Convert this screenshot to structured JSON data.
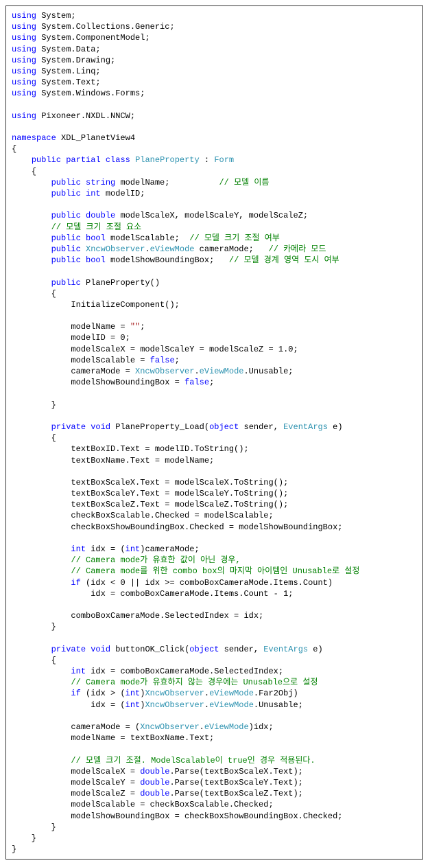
{
  "code": {
    "tokens": [
      {
        "t": "kw",
        "v": "using"
      },
      {
        "v": " System;\n"
      },
      {
        "t": "kw",
        "v": "using"
      },
      {
        "v": " System.Collections.Generic;\n"
      },
      {
        "t": "kw",
        "v": "using"
      },
      {
        "v": " System.ComponentModel;\n"
      },
      {
        "t": "kw",
        "v": "using"
      },
      {
        "v": " System.Data;\n"
      },
      {
        "t": "kw",
        "v": "using"
      },
      {
        "v": " System.Drawing;\n"
      },
      {
        "t": "kw",
        "v": "using"
      },
      {
        "v": " System.Linq;\n"
      },
      {
        "t": "kw",
        "v": "using"
      },
      {
        "v": " System.Text;\n"
      },
      {
        "t": "kw",
        "v": "using"
      },
      {
        "v": " System.Windows.Forms;\n"
      },
      {
        "v": "\n"
      },
      {
        "t": "kw",
        "v": "using"
      },
      {
        "v": " Pixoneer.NXDL.NNCW;\n"
      },
      {
        "v": "\n"
      },
      {
        "t": "kw",
        "v": "namespace"
      },
      {
        "v": " XDL_PlanetView4\n"
      },
      {
        "v": "{\n"
      },
      {
        "v": "    "
      },
      {
        "t": "kw",
        "v": "public"
      },
      {
        "v": " "
      },
      {
        "t": "kw",
        "v": "partial"
      },
      {
        "v": " "
      },
      {
        "t": "kw",
        "v": "class"
      },
      {
        "v": " "
      },
      {
        "t": "type",
        "v": "PlaneProperty"
      },
      {
        "v": " : "
      },
      {
        "t": "type",
        "v": "Form"
      },
      {
        "v": "\n"
      },
      {
        "v": "    {\n"
      },
      {
        "v": "        "
      },
      {
        "t": "kw",
        "v": "public"
      },
      {
        "v": " "
      },
      {
        "t": "kw",
        "v": "string"
      },
      {
        "v": " modelName;          "
      },
      {
        "t": "cm",
        "v": "// 모델 이름"
      },
      {
        "v": "\n"
      },
      {
        "v": "        "
      },
      {
        "t": "kw",
        "v": "public"
      },
      {
        "v": " "
      },
      {
        "t": "kw",
        "v": "int"
      },
      {
        "v": " modelID;\n"
      },
      {
        "v": "\n"
      },
      {
        "v": "        "
      },
      {
        "t": "kw",
        "v": "public"
      },
      {
        "v": " "
      },
      {
        "t": "kw",
        "v": "double"
      },
      {
        "v": " modelScaleX, modelScaleY, modelScaleZ;\n"
      },
      {
        "v": "        "
      },
      {
        "t": "cm",
        "v": "// 모델 크기 조절 요소"
      },
      {
        "v": "\n"
      },
      {
        "v": "        "
      },
      {
        "t": "kw",
        "v": "public"
      },
      {
        "v": " "
      },
      {
        "t": "kw",
        "v": "bool"
      },
      {
        "v": " modelScalable;  "
      },
      {
        "t": "cm",
        "v": "// 모델 크기 조절 여부"
      },
      {
        "v": "\n"
      },
      {
        "v": "        "
      },
      {
        "t": "kw",
        "v": "public"
      },
      {
        "v": " "
      },
      {
        "t": "type",
        "v": "XncwObserver"
      },
      {
        "v": "."
      },
      {
        "t": "type",
        "v": "eViewMode"
      },
      {
        "v": " cameraMode;   "
      },
      {
        "t": "cm",
        "v": "// 카메라 모드"
      },
      {
        "v": "\n"
      },
      {
        "v": "        "
      },
      {
        "t": "kw",
        "v": "public"
      },
      {
        "v": " "
      },
      {
        "t": "kw",
        "v": "bool"
      },
      {
        "v": " modelShowBoundingBox;   "
      },
      {
        "t": "cm",
        "v": "// 모델 경계 영역 도시 여부"
      },
      {
        "v": "\n"
      },
      {
        "v": "\n"
      },
      {
        "v": "        "
      },
      {
        "t": "kw",
        "v": "public"
      },
      {
        "v": " PlaneProperty()\n"
      },
      {
        "v": "        {\n"
      },
      {
        "v": "            InitializeComponent();\n"
      },
      {
        "v": "\n"
      },
      {
        "v": "            modelName = "
      },
      {
        "t": "str",
        "v": "\"\""
      },
      {
        "v": ";\n"
      },
      {
        "v": "            modelID = 0;\n"
      },
      {
        "v": "            modelScaleX = modelScaleY = modelScaleZ = 1.0;\n"
      },
      {
        "v": "            modelScalable = "
      },
      {
        "t": "kw",
        "v": "false"
      },
      {
        "v": ";\n"
      },
      {
        "v": "            cameraMode = "
      },
      {
        "t": "type",
        "v": "XncwObserver"
      },
      {
        "v": "."
      },
      {
        "t": "type",
        "v": "eViewMode"
      },
      {
        "v": ".Unusable;\n"
      },
      {
        "v": "            modelShowBoundingBox = "
      },
      {
        "t": "kw",
        "v": "false"
      },
      {
        "v": ";\n"
      },
      {
        "v": "\n"
      },
      {
        "v": "        }\n"
      },
      {
        "v": "\n"
      },
      {
        "v": "        "
      },
      {
        "t": "kw",
        "v": "private"
      },
      {
        "v": " "
      },
      {
        "t": "kw",
        "v": "void"
      },
      {
        "v": " PlaneProperty_Load("
      },
      {
        "t": "kw",
        "v": "object"
      },
      {
        "v": " sender, "
      },
      {
        "t": "type",
        "v": "EventArgs"
      },
      {
        "v": " e)\n"
      },
      {
        "v": "        {\n"
      },
      {
        "v": "            textBoxID.Text = modelID.ToString();\n"
      },
      {
        "v": "            textBoxName.Text = modelName;\n"
      },
      {
        "v": "\n"
      },
      {
        "v": "            textBoxScaleX.Text = modelScaleX.ToString();\n"
      },
      {
        "v": "            textBoxScaleY.Text = modelScaleY.ToString();\n"
      },
      {
        "v": "            textBoxScaleZ.Text = modelScaleZ.ToString();\n"
      },
      {
        "v": "            checkBoxScalable.Checked = modelScalable;\n"
      },
      {
        "v": "            checkBoxShowBoundingBox.Checked = modelShowBoundingBox;\n"
      },
      {
        "v": "\n"
      },
      {
        "v": "            "
      },
      {
        "t": "kw",
        "v": "int"
      },
      {
        "v": " idx = ("
      },
      {
        "t": "kw",
        "v": "int"
      },
      {
        "v": ")cameraMode;\n"
      },
      {
        "v": "            "
      },
      {
        "t": "cm",
        "v": "// Camera mode가 유효한 값이 아닌 경우,"
      },
      {
        "v": "\n"
      },
      {
        "v": "            "
      },
      {
        "t": "cm",
        "v": "// Camera mode를 위한 combo box의 마지막 아이템인 Unusable로 설정"
      },
      {
        "v": "\n"
      },
      {
        "v": "            "
      },
      {
        "t": "kw",
        "v": "if"
      },
      {
        "v": " (idx < 0 || idx >= comboBoxCameraMode.Items.Count)\n"
      },
      {
        "v": "                idx = comboBoxCameraMode.Items.Count - 1;\n"
      },
      {
        "v": "\n"
      },
      {
        "v": "            comboBoxCameraMode.SelectedIndex = idx;\n"
      },
      {
        "v": "        }\n"
      },
      {
        "v": "\n"
      },
      {
        "v": "        "
      },
      {
        "t": "kw",
        "v": "private"
      },
      {
        "v": " "
      },
      {
        "t": "kw",
        "v": "void"
      },
      {
        "v": " buttonOK_Click("
      },
      {
        "t": "kw",
        "v": "object"
      },
      {
        "v": " sender, "
      },
      {
        "t": "type",
        "v": "EventArgs"
      },
      {
        "v": " e)\n"
      },
      {
        "v": "        {\n"
      },
      {
        "v": "            "
      },
      {
        "t": "kw",
        "v": "int"
      },
      {
        "v": " idx = comboBoxCameraMode.SelectedIndex;\n"
      },
      {
        "v": "            "
      },
      {
        "t": "cm",
        "v": "// Camera mode가 유효하지 않는 경우에는 Unusable으로 설정"
      },
      {
        "v": "\n"
      },
      {
        "v": "            "
      },
      {
        "t": "kw",
        "v": "if"
      },
      {
        "v": " (idx > ("
      },
      {
        "t": "kw",
        "v": "int"
      },
      {
        "v": ")"
      },
      {
        "t": "type",
        "v": "XncwObserver"
      },
      {
        "v": "."
      },
      {
        "t": "type",
        "v": "eViewMode"
      },
      {
        "v": ".Far2Obj)\n"
      },
      {
        "v": "                idx = ("
      },
      {
        "t": "kw",
        "v": "int"
      },
      {
        "v": ")"
      },
      {
        "t": "type",
        "v": "XncwObserver"
      },
      {
        "v": "."
      },
      {
        "t": "type",
        "v": "eViewMode"
      },
      {
        "v": ".Unusable;\n"
      },
      {
        "v": "\n"
      },
      {
        "v": "            cameraMode = ("
      },
      {
        "t": "type",
        "v": "XncwObserver"
      },
      {
        "v": "."
      },
      {
        "t": "type",
        "v": "eViewMode"
      },
      {
        "v": ")idx;\n"
      },
      {
        "v": "            modelName = textBoxName.Text;\n"
      },
      {
        "v": "\n"
      },
      {
        "v": "            "
      },
      {
        "t": "cm",
        "v": "// 모델 크기 조절. ModelScalable이 true인 경우 적용된다."
      },
      {
        "v": "\n"
      },
      {
        "v": "            modelScaleX = "
      },
      {
        "t": "kw",
        "v": "double"
      },
      {
        "v": ".Parse(textBoxScaleX.Text);\n"
      },
      {
        "v": "            modelScaleY = "
      },
      {
        "t": "kw",
        "v": "double"
      },
      {
        "v": ".Parse(textBoxScaleY.Text);\n"
      },
      {
        "v": "            modelScaleZ = "
      },
      {
        "t": "kw",
        "v": "double"
      },
      {
        "v": ".Parse(textBoxScaleZ.Text);\n"
      },
      {
        "v": "            modelScalable = checkBoxScalable.Checked;\n"
      },
      {
        "v": "            modelShowBoundingBox = checkBoxShowBoundingBox.Checked;\n"
      },
      {
        "v": "        }\n"
      },
      {
        "v": "    }\n"
      },
      {
        "v": "}\n"
      }
    ]
  }
}
